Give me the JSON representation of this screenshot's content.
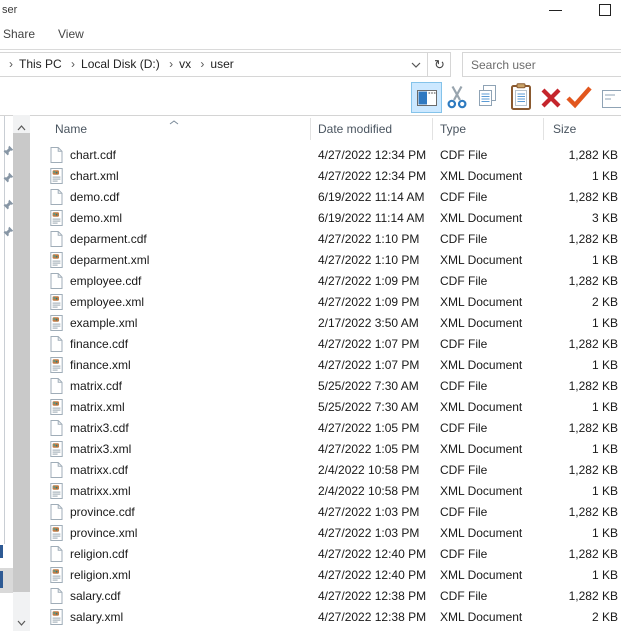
{
  "window": {
    "title_partial": "ser"
  },
  "menu": {
    "items": [
      "Share",
      "View"
    ]
  },
  "breadcrumb": {
    "separator": "›",
    "items": [
      "This PC",
      "Local Disk (D:)",
      "vx",
      "user"
    ]
  },
  "search": {
    "placeholder": "Search user"
  },
  "toolbar": {
    "buttons": [
      "preview-pane-toggle",
      "cut",
      "copy",
      "paste",
      "delete",
      "apply-check",
      "form-partial"
    ],
    "selected_button": "preview-pane-toggle"
  },
  "nav": {
    "pinned_count": 4
  },
  "list": {
    "columns": {
      "name": "Name",
      "date": "Date modified",
      "type": "Type",
      "size": "Size"
    },
    "sort": {
      "column": "Name",
      "direction": "ascending"
    },
    "files": [
      {
        "name": "chart.cdf",
        "date": "4/27/2022 12:34 PM",
        "type": "CDF File",
        "size": "1,282 KB",
        "icon": "cdf"
      },
      {
        "name": "chart.xml",
        "date": "4/27/2022 12:34 PM",
        "type": "XML Document",
        "size": "1 KB",
        "icon": "xml"
      },
      {
        "name": "demo.cdf",
        "date": "6/19/2022 11:14 AM",
        "type": "CDF File",
        "size": "1,282 KB",
        "icon": "cdf"
      },
      {
        "name": "demo.xml",
        "date": "6/19/2022 11:14 AM",
        "type": "XML Document",
        "size": "3 KB",
        "icon": "xml"
      },
      {
        "name": "deparment.cdf",
        "date": "4/27/2022 1:10 PM",
        "type": "CDF File",
        "size": "1,282 KB",
        "icon": "cdf"
      },
      {
        "name": "deparment.xml",
        "date": "4/27/2022 1:10 PM",
        "type": "XML Document",
        "size": "1 KB",
        "icon": "xml"
      },
      {
        "name": "employee.cdf",
        "date": "4/27/2022 1:09 PM",
        "type": "CDF File",
        "size": "1,282 KB",
        "icon": "cdf"
      },
      {
        "name": "employee.xml",
        "date": "4/27/2022 1:09 PM",
        "type": "XML Document",
        "size": "2 KB",
        "icon": "xml"
      },
      {
        "name": "example.xml",
        "date": "2/17/2022 3:50 AM",
        "type": "XML Document",
        "size": "1 KB",
        "icon": "xml"
      },
      {
        "name": "finance.cdf",
        "date": "4/27/2022 1:07 PM",
        "type": "CDF File",
        "size": "1,282 KB",
        "icon": "cdf"
      },
      {
        "name": "finance.xml",
        "date": "4/27/2022 1:07 PM",
        "type": "XML Document",
        "size": "1 KB",
        "icon": "xml"
      },
      {
        "name": "matrix.cdf",
        "date": "5/25/2022 7:30 AM",
        "type": "CDF File",
        "size": "1,282 KB",
        "icon": "cdf"
      },
      {
        "name": "matrix.xml",
        "date": "5/25/2022 7:30 AM",
        "type": "XML Document",
        "size": "1 KB",
        "icon": "xml"
      },
      {
        "name": "matrix3.cdf",
        "date": "4/27/2022 1:05 PM",
        "type": "CDF File",
        "size": "1,282 KB",
        "icon": "cdf"
      },
      {
        "name": "matrix3.xml",
        "date": "4/27/2022 1:05 PM",
        "type": "XML Document",
        "size": "1 KB",
        "icon": "xml"
      },
      {
        "name": "matrixx.cdf",
        "date": "2/4/2022 10:58 PM",
        "type": "CDF File",
        "size": "1,282 KB",
        "icon": "cdf"
      },
      {
        "name": "matrixx.xml",
        "date": "2/4/2022 10:58 PM",
        "type": "XML Document",
        "size": "1 KB",
        "icon": "xml"
      },
      {
        "name": "province.cdf",
        "date": "4/27/2022 1:03 PM",
        "type": "CDF File",
        "size": "1,282 KB",
        "icon": "cdf"
      },
      {
        "name": "province.xml",
        "date": "4/27/2022 1:03 PM",
        "type": "XML Document",
        "size": "1 KB",
        "icon": "xml"
      },
      {
        "name": "religion.cdf",
        "date": "4/27/2022 12:40 PM",
        "type": "CDF File",
        "size": "1,282 KB",
        "icon": "cdf"
      },
      {
        "name": "religion.xml",
        "date": "4/27/2022 12:40 PM",
        "type": "XML Document",
        "size": "1 KB",
        "icon": "xml"
      },
      {
        "name": "salary.cdf",
        "date": "4/27/2022 12:38 PM",
        "type": "CDF File",
        "size": "1,282 KB",
        "icon": "cdf"
      },
      {
        "name": "salary.xml",
        "date": "4/27/2022 12:38 PM",
        "type": "XML Document",
        "size": "2 KB",
        "icon": "xml"
      }
    ]
  },
  "colors": {
    "accent_blue": "#2e7bc0",
    "selection_bg": "#cce8ff",
    "selection_border": "#84c3ea",
    "delete_red": "#c5252c",
    "check_orange": "#e2571e"
  }
}
